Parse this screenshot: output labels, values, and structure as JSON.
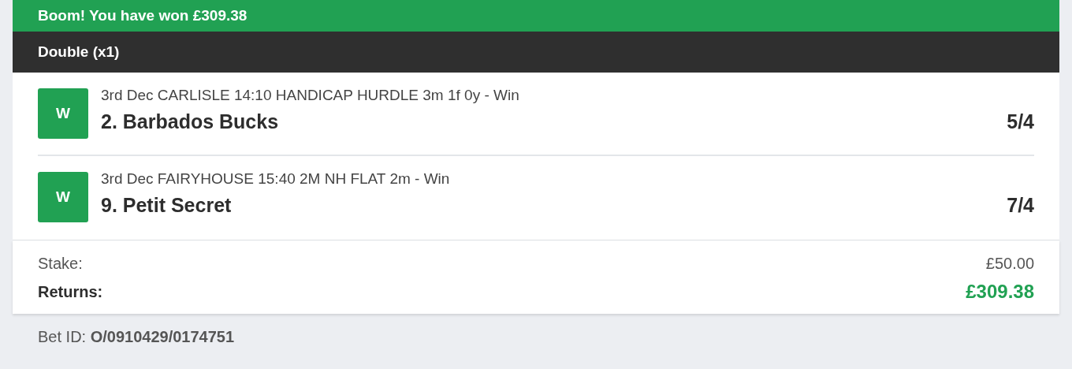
{
  "banner": {
    "text": "Boom! You have won £309.38"
  },
  "bet_type": {
    "title": "Double (x1)"
  },
  "selections": [
    {
      "result": "W",
      "event": "3rd Dec CARLISLE 14:10 HANDICAP HURDLE 3m 1f 0y - Win",
      "runner": "2. Barbados Bucks",
      "odds": "5/4"
    },
    {
      "result": "W",
      "event": "3rd Dec FAIRYHOUSE 15:40 2M NH FLAT 2m - Win",
      "runner": "9. Petit Secret",
      "odds": "7/4"
    }
  ],
  "totals": [
    {
      "kind": "stake",
      "label": "Stake:",
      "value": "£50.00"
    },
    {
      "kind": "returns",
      "label": "Returns:",
      "value": "£309.38"
    }
  ],
  "bet_id": "Bet ID: **O/0910429/0174751**"
}
